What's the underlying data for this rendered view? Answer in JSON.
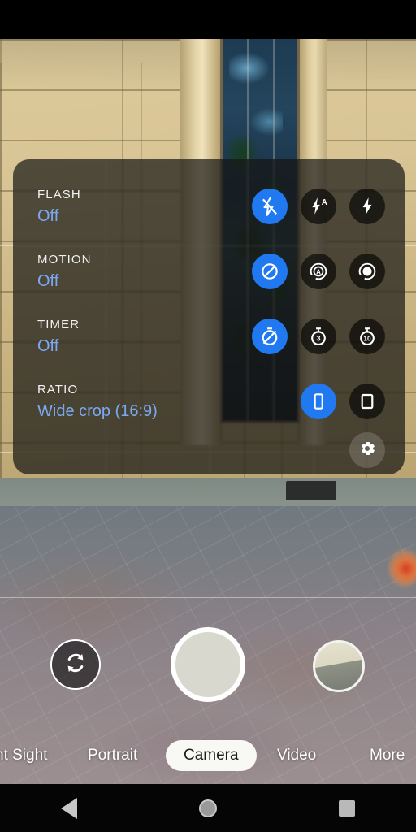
{
  "app": {
    "name": "Camera",
    "screen": "viewfinder-with-quick-settings"
  },
  "quick_settings": {
    "rows": [
      {
        "title": "FLASH",
        "value": "Off",
        "options": [
          {
            "name": "flash-off-icon",
            "label": "Off",
            "selected": true
          },
          {
            "name": "flash-auto-icon",
            "label": "Auto",
            "selected": false
          },
          {
            "name": "flash-on-icon",
            "label": "On",
            "selected": false
          }
        ]
      },
      {
        "title": "MOTION",
        "value": "Off",
        "options": [
          {
            "name": "motion-off-icon",
            "label": "Off",
            "selected": true
          },
          {
            "name": "motion-auto-icon",
            "label": "Auto",
            "selected": false
          },
          {
            "name": "motion-on-icon",
            "label": "On",
            "selected": false
          }
        ]
      },
      {
        "title": "TIMER",
        "value": "Off",
        "options": [
          {
            "name": "timer-off-icon",
            "label": "Off",
            "selected": true
          },
          {
            "name": "timer-3s-icon",
            "label": "3",
            "selected": false
          },
          {
            "name": "timer-10s-icon",
            "label": "10",
            "selected": false
          }
        ]
      },
      {
        "title": "RATIO",
        "value": "Wide crop (16:9)",
        "options": [
          {
            "name": "ratio-16-9-icon",
            "label": "16:9",
            "selected": true
          },
          {
            "name": "ratio-4-3-icon",
            "label": "4:3",
            "selected": false
          }
        ]
      }
    ],
    "settings_button": {
      "name": "gear-icon",
      "label": "Settings"
    }
  },
  "controls": {
    "flip_camera": "Switch camera",
    "shutter": "Take photo",
    "thumbnail": "Last photo"
  },
  "modes": [
    {
      "label": "ht Sight",
      "active": false
    },
    {
      "label": "Portrait",
      "active": false
    },
    {
      "label": "Camera",
      "active": true
    },
    {
      "label": "Video",
      "active": false
    },
    {
      "label": "More",
      "active": false
    }
  ],
  "navbar": [
    {
      "label": "Back",
      "icon": "back-triangle-icon"
    },
    {
      "label": "Home",
      "icon": "home-circle-icon"
    },
    {
      "label": "Recents",
      "icon": "recents-square-icon"
    }
  ],
  "colors": {
    "accent_blue": "#2079f0",
    "value_text_blue": "#7aa9f2",
    "panel_background": "rgba(22,22,20,0.70)",
    "active_mode_pill": "#f8f8f4"
  }
}
